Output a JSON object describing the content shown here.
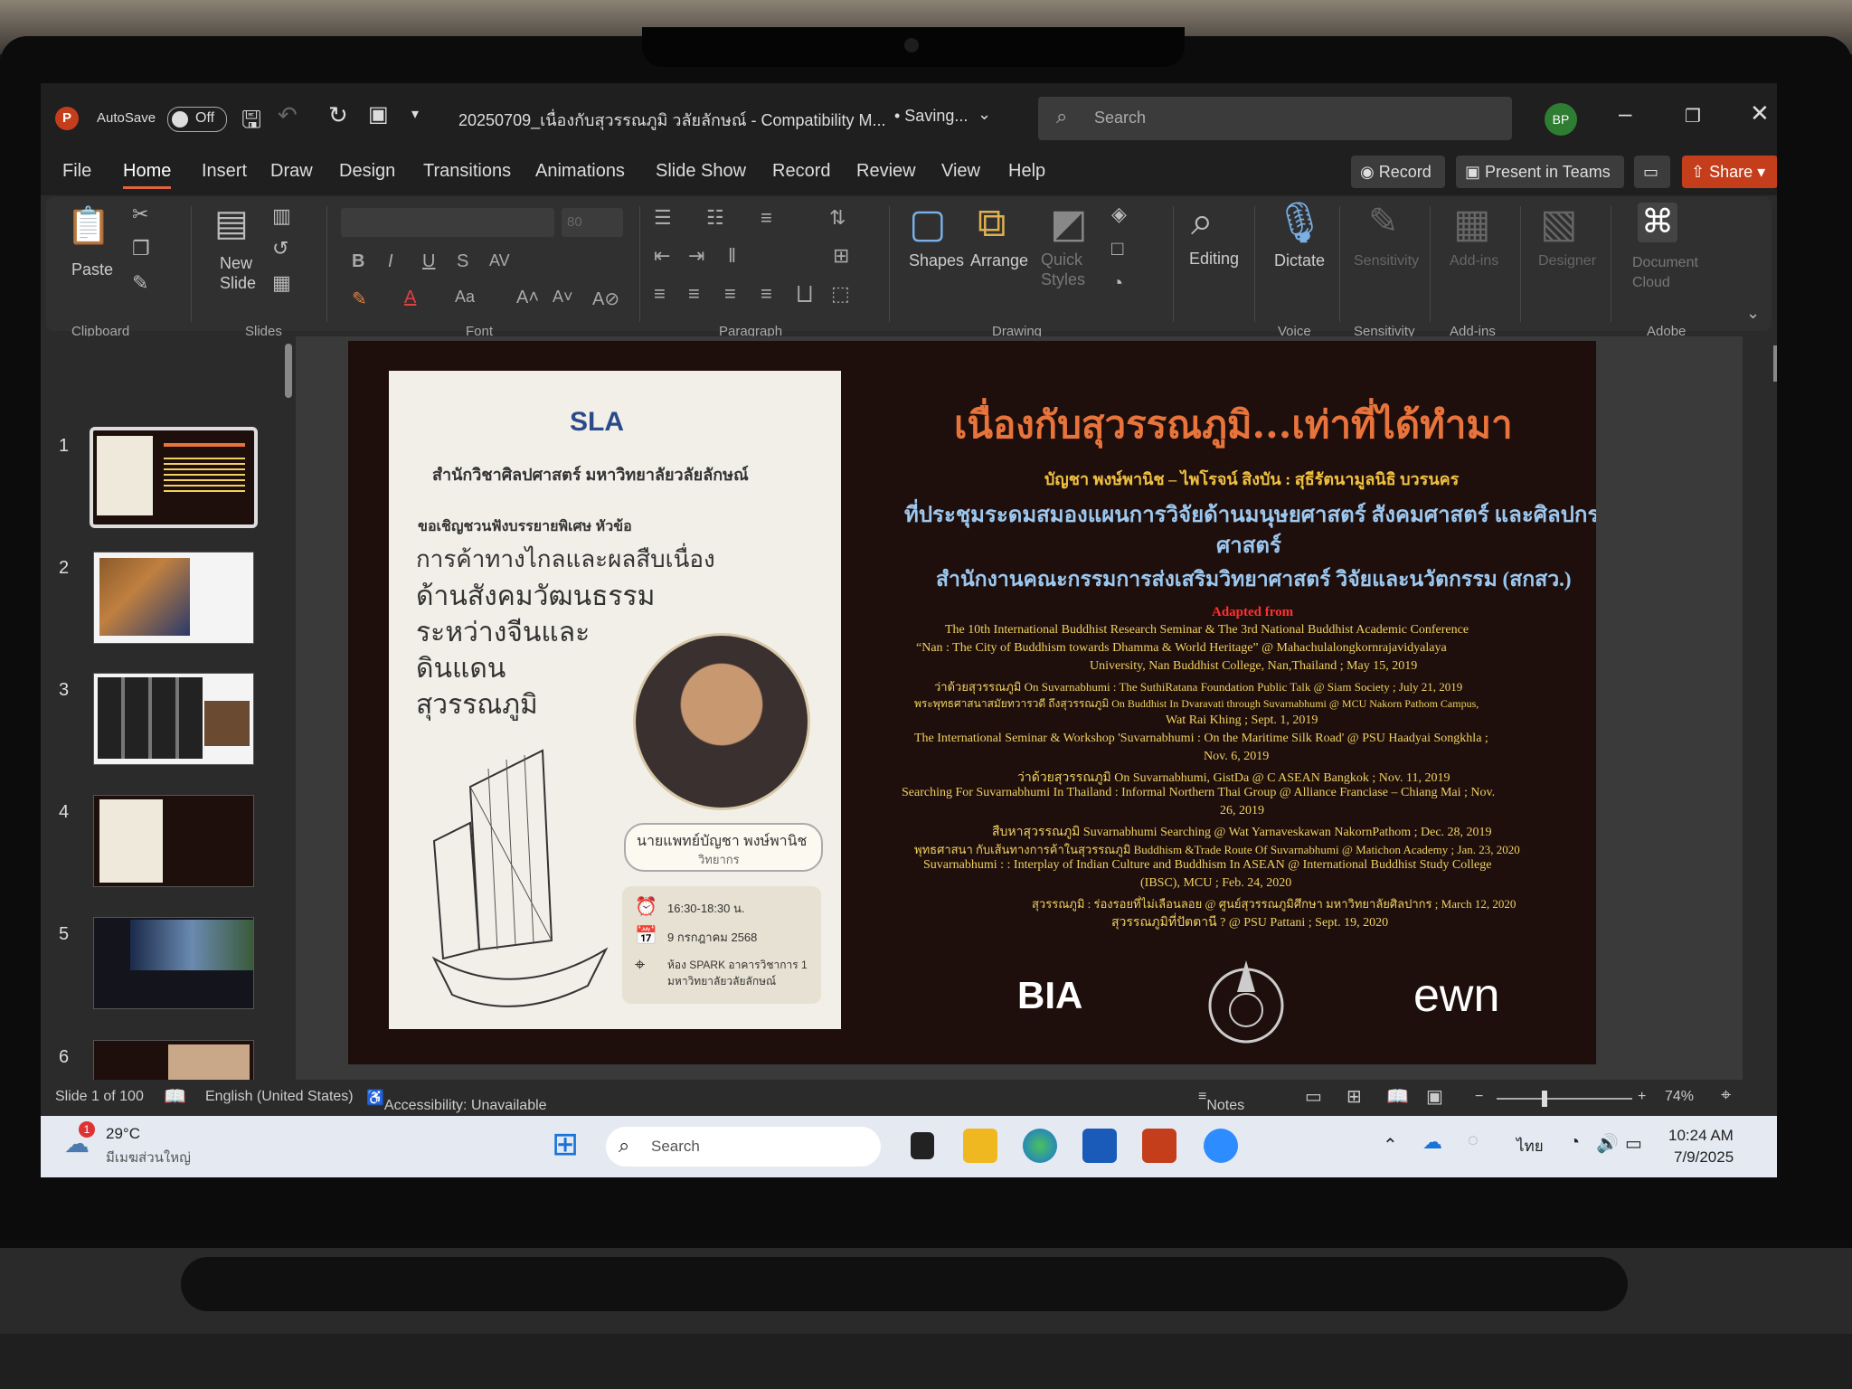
{
  "window": {
    "autosave_label": "AutoSave",
    "autosave_state": "Off",
    "doc_title": "20250709_เนื่องกับสุวรรณภูมิ วลัยลักษณ์ - Compatibility M...",
    "save_status": "• Saving...",
    "search_placeholder": "Search",
    "user_initials": "BP"
  },
  "menu": {
    "items": [
      "File",
      "Home",
      "Insert",
      "Draw",
      "Design",
      "Transitions",
      "Animations",
      "Slide Show",
      "Record",
      "Review",
      "View",
      "Help"
    ],
    "record_label": "Record",
    "present_label": "Present in Teams",
    "share_label": "Share"
  },
  "ribbon": {
    "paste": "Paste",
    "new_slide": "New Slide",
    "shapes": "Shapes",
    "arrange": "Arrange",
    "quick_styles": "Quick Styles",
    "editing": "Editing",
    "dictate": "Dictate",
    "sensitivity": "Sensitivity",
    "addins": "Add-ins",
    "designer": "Designer",
    "doc_cloud": "Document Cloud",
    "font_size": "80",
    "groups": {
      "clipboard": "Clipboard",
      "slides": "Slides",
      "font": "Font",
      "paragraph": "Paragraph",
      "drawing": "Drawing",
      "voice": "Voice",
      "sensitivity": "Sensitivity",
      "addins": "Add-ins",
      "adobe": "Adobe"
    }
  },
  "thumbnails": [
    "1",
    "2",
    "3",
    "4",
    "5",
    "6"
  ],
  "slide": {
    "poster": {
      "logo": "SLA",
      "school": "สำนักวิชาศิลปศาสตร์ มหาวิทยาลัยวลัยลักษณ์",
      "invite": "ขอเชิญชวนฟังบรรยายพิเศษ หัวข้อ",
      "topic1": "การค้าทางไกลและผลสืบเนื่อง",
      "topic2": "ด้านสังคมวัฒนธรรม",
      "topic3": "ระหว่างจีนและ",
      "topic4": "ดินแดน",
      "topic5": "สุวรรณภูมิ",
      "speaker": "นายแพทย์บัญชา พงษ์พานิช",
      "speaker_role": "วิทยากร",
      "time": "16:30-18:30 น.",
      "date": "9 กรกฎาคม 2568",
      "venue1": "ห้อง SPARK อาคารวิชาการ 1",
      "venue2": "มหาวิทยาลัยวลัยลักษณ์"
    },
    "title": "เนื่องกับสุวรรณภูมิ...เท่าที่ได้ทำมา",
    "authors": "บัญชา พงษ์พานิช – ไพโรจน์ สิงบัน : สุธีรัตนามูลนิธิ บวรนคร",
    "conf1": "ที่ประชุมระดมสมองแผนการวิจัยด้านมนุษยศาสตร์ สังคมศาสตร์ และศิลปกรรม",
    "conf2": "ศาสตร์",
    "agency": "สำนักงานคณะกรรมการส่งเสริมวิทยาศาสตร์ วิจัยและนวัตกรรม (สกสว.)",
    "adapted": "Adapted from",
    "refs": [
      "The 10th International Buddhist Research Seminar  & The 3rd National Buddhist Academic Conference",
      "“Nan : The City of Buddhism towards Dhamma & World Heritage” @ Mahachulalongkornrajavidyalaya",
      "University,  Nan Buddhist College, Nan,Thailand ; May 15, 2019",
      "ว่าด้วยสุวรรณภูมิ On Suvarnabhumi : The SuthiRatana Foundation Public Talk @ Siam Society ; July 21, 2019",
      "พระพุทธศาสนาสมัยทวารวดี ถึงสุวรรณภูมิ On Buddhist In Dvaravati through Suvarnabhumi @ MCU Nakorn Pathom Campus,",
      "Wat Rai Khing ; Sept. 1, 2019",
      "The International Seminar & Workshop 'Suvarnabhumi : On the Maritime Silk Road' @ PSU Haadyai Songkhla ;",
      "Nov. 6, 2019",
      "ว่าด้วยสุวรรณภูมิ On Suvarnabhumi, GistDa @ C ASEAN Bangkok ; Nov. 11, 2019",
      "Searching For Suvarnabhumi In Thailand : Informal Northern Thai Group @ Alliance Franciase – Chiang Mai ; Nov.",
      "26, 2019",
      "สืบหาสุวรรณภูมิ Suvarnabhumi Searching @ Wat Yarnaveskawan NakornPathom ; Dec. 28, 2019",
      "พุทธศาสนา กับเส้นทางการค้าในสุวรรณภูมิ Buddhism &Trade Route Of Suvarnabhumi @ Matichon Academy ; Jan. 23, 2020",
      "Suvarnabhumi : : Interplay of Indian Culture and Buddhism In ASEAN @ International Buddhist Study College",
      "(IBSC), MCU ; Feb. 24, 2020",
      "สุวรรณภูมิ : ร่องรอยที่ไม่เลือนลอย @ ศูนย์สุวรรณภูมิศึกษา มหาวิทยาลัยศิลปากร ; March 12, 2020",
      "สุวรรณภูมิที่ปัตตานี ? @ PSU Pattani ; Sept. 19, 2020"
    ],
    "logo_bia": "BIA",
    "logo_swn": "ewn"
  },
  "status": {
    "slide_count": "Slide 1 of 100",
    "language": "English (United States)",
    "accessibility": "Accessibility: Unavailable",
    "notes": "Notes",
    "zoom": "74%"
  },
  "taskbar": {
    "weather_temp": "29°C",
    "weather_desc": "มีเมฆส่วนใหญ่",
    "weather_badge": "1",
    "search": "Search",
    "lang": "ไทย",
    "time": "10:24 AM",
    "date": "7/9/2025"
  },
  "colors": {
    "accent": "#c43e1c",
    "slide_bg": "#1e0f0c",
    "slide_title": "#e8743c",
    "ref_text": "#f0d060",
    "ref_red": "#ff3030"
  }
}
